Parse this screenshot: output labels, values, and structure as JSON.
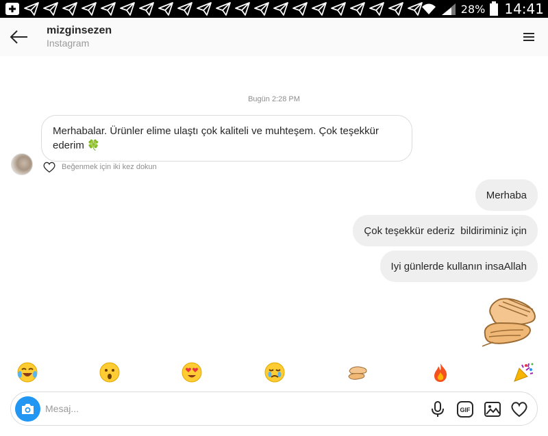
{
  "status_bar": {
    "battery": "28%",
    "time": "14:41",
    "notification_icons": [
      "add-box-icon",
      "telegram-icon",
      "telegram-icon",
      "telegram-icon",
      "telegram-icon",
      "telegram-icon",
      "telegram-icon",
      "telegram-icon",
      "telegram-icon",
      "telegram-icon",
      "telegram-icon",
      "telegram-icon",
      "telegram-icon",
      "telegram-icon",
      "telegram-icon",
      "telegram-icon",
      "telegram-icon",
      "telegram-icon",
      "telegram-icon",
      "telegram-icon",
      "telegram-icon",
      "telegram-icon"
    ]
  },
  "header": {
    "username": "mizginsezen",
    "subtitle": "Instagram"
  },
  "chat": {
    "timestamp": "Bugün 2:28 PM",
    "incoming": {
      "text": "Merhabalar. Ürünler elime ulaştı çok kaliteli ve muhteşem. Çok teşekkür ederim",
      "emoji": "🍀",
      "like_hint": "Beğenmek için iki kez dokun"
    },
    "outgoing": [
      {
        "text": "Merhaba"
      },
      {
        "text": "Çok teşekkür ederiz  bildiriminiz için"
      },
      {
        "text": "Iyi günlerde kullanın insaAllah"
      }
    ],
    "sticker": "clapping-hands-emoji"
  },
  "reactions": [
    {
      "name": "tears-of-joy-emoji",
      "glyph": "😂"
    },
    {
      "name": "surprised-emoji",
      "glyph": "😮"
    },
    {
      "name": "heart-eyes-emoji",
      "glyph": "😍"
    },
    {
      "name": "crying-emoji",
      "glyph": "😢"
    },
    {
      "name": "clapping-emoji",
      "glyph": "👏"
    },
    {
      "name": "fire-emoji",
      "glyph": "🔥"
    },
    {
      "name": "party-popper-emoji",
      "glyph": "🎉"
    }
  ],
  "composer": {
    "placeholder": "Mesaj...",
    "icons": [
      "microphone-icon",
      "gif-icon",
      "gallery-icon",
      "heart-icon"
    ]
  },
  "colors": {
    "accent": "#2196f3",
    "bubble_out": "#efefef",
    "status_bar": "#000000"
  }
}
